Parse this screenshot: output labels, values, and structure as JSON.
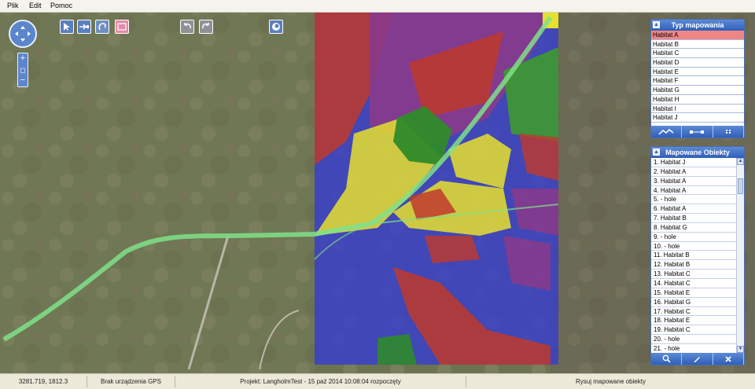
{
  "menu": {
    "items": [
      "Plik",
      "Edit",
      "Pomoc"
    ]
  },
  "map": {
    "zoom_plus": "+",
    "zoom_minus": "−",
    "zoom_reset": "◻"
  },
  "types_panel": {
    "title": "Typ mapowania",
    "selected": "Habitat A",
    "items": [
      "Habitat A",
      "Habitat B",
      "Habitat C",
      "Habitat D",
      "Habitat E",
      "Habitat F",
      "Habitat G",
      "Habitat H",
      "Habitat I",
      "Habitat J"
    ]
  },
  "objects_panel": {
    "title": "Mapowane Obiekty",
    "items": [
      "1. Habitat J",
      "2. Habitat A",
      "3. Habitat A",
      "4. Habitat A",
      "5. - hole",
      "6. Habitat A",
      "7. Habitat B",
      "8. Habitat G",
      "9. - hole",
      "10. - hole",
      "11. Habitat B",
      "12. Habitat B",
      "13. Habitat C",
      "14. Habitat C",
      "15. Habitat E",
      "16. Habitat G",
      "17. Habitat C",
      "18. Habitat E",
      "19. Habitat C",
      "20. - hole",
      "21. - hole"
    ]
  },
  "status": {
    "coords": "3281.719, 1812.3",
    "gps": "Brak urządzenia GPS",
    "project": "Projekt: LangholmTest - 15 paź 2014 10:08:04 rozpoczęty",
    "mode": "Rysuj mapowane obiekty"
  },
  "colors": {
    "panel_header": "#2f5fb8",
    "selected_row": "#f08585",
    "habitat_red": "#d03a2a",
    "habitat_yellow": "#e6e02e",
    "habitat_blue": "#3a3fc8",
    "habitat_green": "#3d9a2e",
    "habitat_purple": "#8a3a8a",
    "track_green": "#7fe08a"
  }
}
